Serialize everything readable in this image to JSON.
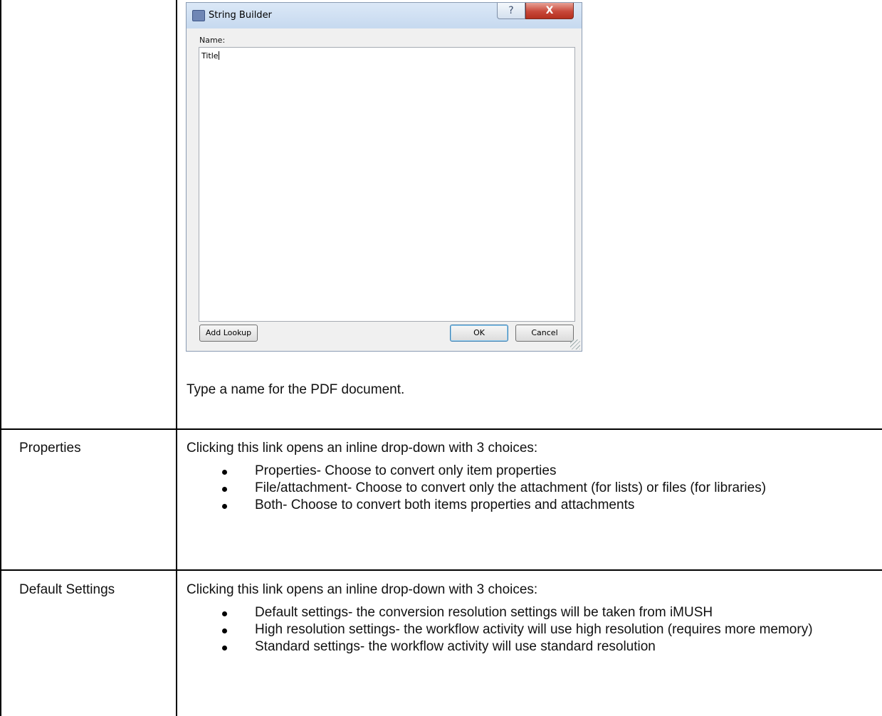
{
  "dialog": {
    "title": "String Builder",
    "help_label": "?",
    "close_label": "X",
    "name_label": "Name:",
    "name_value": "Title",
    "add_lookup_label": "Add Lookup",
    "ok_label": "OK",
    "cancel_label": "Cancel"
  },
  "rows": [
    {
      "label": "",
      "description": "Type a name for the PDF document."
    },
    {
      "label": "Properties",
      "intro": "Clicking this link opens an inline drop-down with 3 choices:",
      "bullets": [
        "Properties- Choose to convert only item properties",
        "File/attachment- Choose to convert only the attachment (for lists) or files (for libraries)",
        "Both- Choose to convert both items properties and attachments"
      ]
    },
    {
      "label": "Default Settings",
      "intro": "Clicking this link opens an inline drop-down with 3 choices:",
      "bullets": [
        "Default settings- the conversion resolution settings will be taken from iMUSH",
        "High resolution settings- the workflow activity will use high resolution (requires more memory)",
        "Standard settings- the workflow activity will use standard resolution"
      ]
    }
  ]
}
